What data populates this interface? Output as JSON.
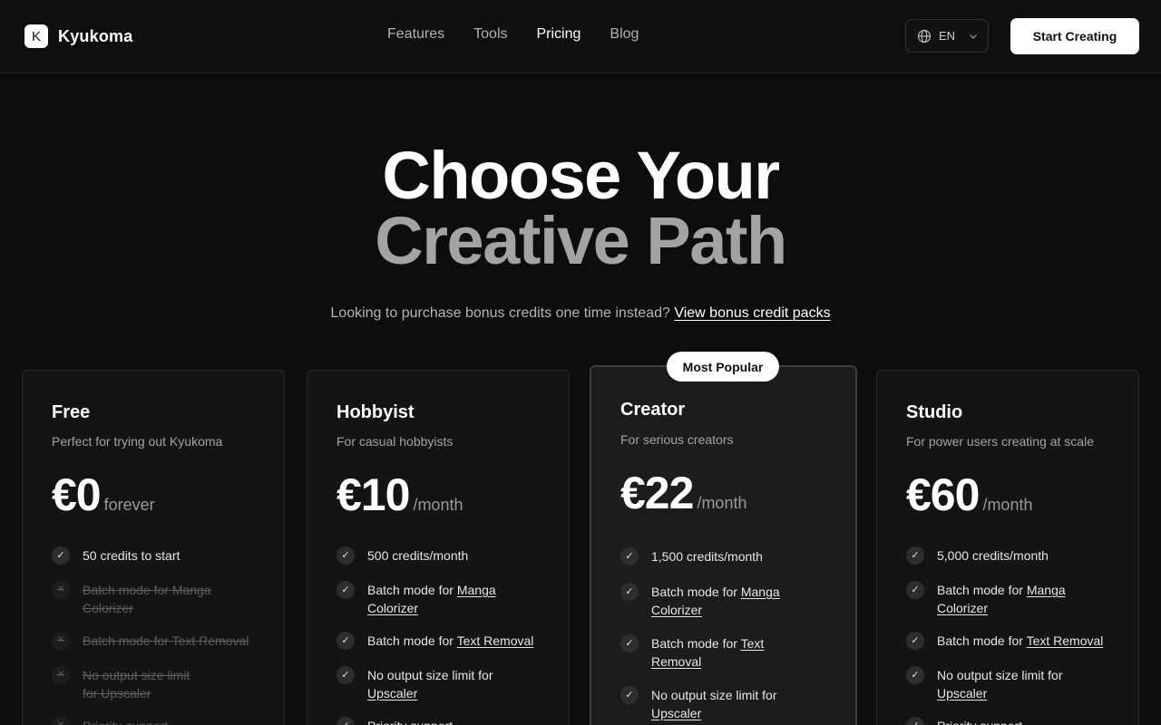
{
  "header": {
    "logo_letter": "K",
    "brand": "Kyukoma",
    "nav": [
      "Features",
      "Tools",
      "Pricing",
      "Blog"
    ],
    "nav_active": "Pricing",
    "lang": "EN",
    "cta": "Start Creating"
  },
  "hero": {
    "title_line1": "Choose Your",
    "title_line2": "Creative Path",
    "sub_text": "Looking to purchase bonus credits one time instead?",
    "sub_link": "View bonus credit packs"
  },
  "plans": [
    {
      "name": "Free",
      "desc": "Perfect for trying out Kyukoma",
      "price": "€0",
      "period": "forever",
      "features": [
        {
          "pre": "50 credits to start",
          "link": "",
          "post": "",
          "on": true
        },
        {
          "pre": "Batch mode for Manga Colorizer",
          "link": "",
          "post": "",
          "on": false
        },
        {
          "pre": "Batch mode for Text Removal",
          "link": "",
          "post": "",
          "on": false
        },
        {
          "pre": "No output size limit for Upscaler",
          "link": "",
          "post": "",
          "on": false
        },
        {
          "pre": "Priority support",
          "link": "",
          "post": "",
          "on": false
        }
      ]
    },
    {
      "name": "Hobbyist",
      "desc": "For casual hobbyists",
      "price": "€10",
      "period": "/month",
      "features": [
        {
          "pre": "500 credits/month",
          "link": "",
          "post": "",
          "on": true
        },
        {
          "pre": "Batch mode for ",
          "link": "Manga Colorizer",
          "post": "",
          "on": true
        },
        {
          "pre": "Batch mode for ",
          "link": "Text Removal",
          "post": "",
          "on": true
        },
        {
          "pre": "No output size limit for ",
          "link": "Upscaler",
          "post": "",
          "on": true
        },
        {
          "pre": "Priority support",
          "link": "",
          "post": "",
          "on": true
        }
      ]
    },
    {
      "name": "Creator",
      "desc": "For serious creators",
      "price": "€22",
      "period": "/month",
      "badge": "Most Popular",
      "features": [
        {
          "pre": "1,500 credits/month",
          "link": "",
          "post": "",
          "on": true
        },
        {
          "pre": "Batch mode for ",
          "link": "Manga Colorizer",
          "post": "",
          "on": true
        },
        {
          "pre": "Batch mode for ",
          "link": "Text Removal",
          "post": "",
          "on": true
        },
        {
          "pre": "No output size limit for ",
          "link": "Upscaler",
          "post": "",
          "on": true
        }
      ]
    },
    {
      "name": "Studio",
      "desc": "For power users creating at scale",
      "price": "€60",
      "period": "/month",
      "features": [
        {
          "pre": "5,000 credits/month",
          "link": "",
          "post": "",
          "on": true
        },
        {
          "pre": "Batch mode for ",
          "link": "Manga Colorizer",
          "post": "",
          "on": true
        },
        {
          "pre": "Batch mode for ",
          "link": "Text Removal",
          "post": "",
          "on": true
        },
        {
          "pre": "No output size limit for ",
          "link": "Upscaler",
          "post": "",
          "on": true
        },
        {
          "pre": "Priority support",
          "link": "",
          "post": "",
          "on": true
        }
      ]
    }
  ],
  "icons": {
    "check": "check-icon",
    "disabled": "x-icon",
    "globe": "globe-icon",
    "chevron": "chevron-down-icon"
  },
  "colors": {
    "background": "#0d0d0d",
    "accent": "#ffffff",
    "muted": "#a3a3a3"
  }
}
